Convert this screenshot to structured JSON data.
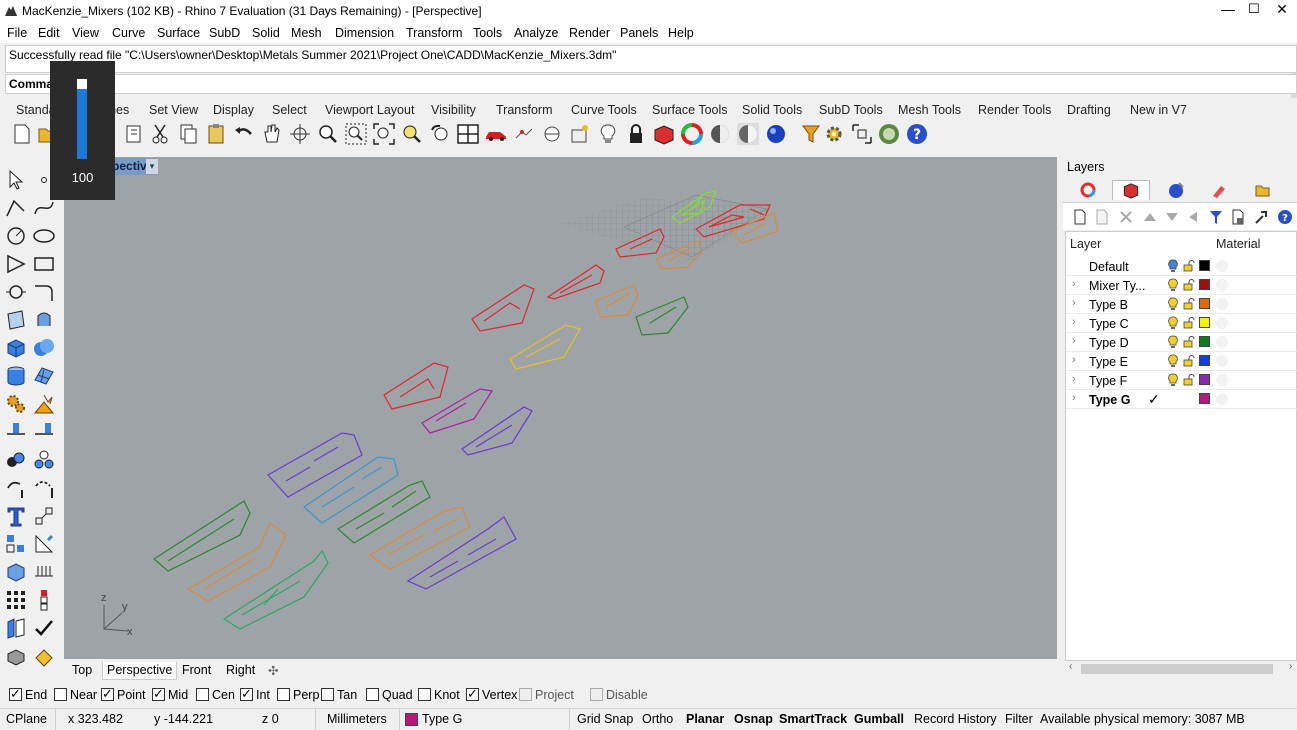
{
  "window": {
    "title": "MacKenzie_Mixers (102 KB) - Rhino 7 Evaluation (31 Days Remaining) - [Perspective]",
    "minimize": "—",
    "maximize": "☐",
    "close": "✕"
  },
  "menu": [
    "File",
    "Edit",
    "View",
    "Curve",
    "Surface",
    "SubD",
    "Solid",
    "Mesh",
    "Dimension",
    "Transform",
    "Tools",
    "Analyze",
    "Render",
    "Panels",
    "Help"
  ],
  "history_text": "Successfully read file \"C:\\Users\\owner\\Desktop\\Metals Summer 2021\\Project One\\CADD\\MacKenzie_Mixers.3dm\"",
  "command_label": "Command:",
  "toolbar_tabs": [
    "Standard",
    "CPlanes",
    "Set View",
    "Display",
    "Select",
    "Viewport Layout",
    "Visibility",
    "Transform",
    "Curve Tools",
    "Surface Tools",
    "Solid Tools",
    "SubD Tools",
    "Mesh Tools",
    "Render Tools",
    "Drafting",
    "New in V7"
  ],
  "toolbar_icons": [
    "new-icon",
    "open-icon",
    "save-icon",
    "print-icon",
    "import-icon",
    "cut-icon",
    "copy-icon",
    "paste-icon",
    "undo-icon",
    "pan-icon",
    "rotate-view-icon",
    "zoom-dynamic-icon",
    "zoom-window-icon",
    "zoom-extents-icon",
    "zoom-selected-icon",
    "undo-view-icon",
    "four-viewports-icon",
    "car-icon",
    "options-icon",
    "cplane-icon",
    "grid-icon",
    "light-icon",
    "lock-icon",
    "shaded-icon",
    "color-wheel-icon",
    "material-icon",
    "rendered-sphere-icon",
    "ghost-sphere-icon",
    "blue-sphere-icon",
    "drafting-icon",
    "settings-icon",
    "gumball-icon",
    "globe-icon",
    "help-icon"
  ],
  "opacity_popup": {
    "value": "100",
    "level": 1.0
  },
  "viewport": {
    "label": "Perspective",
    "dropdown": "▾",
    "axis_x": "x",
    "axis_y": "y",
    "axis_z": "z"
  },
  "view_tabs": [
    "Top",
    "Perspective",
    "Front",
    "Right",
    "✣"
  ],
  "active_view_tab": "Perspective",
  "osnaps": [
    {
      "label": "End",
      "checked": true
    },
    {
      "label": "Near",
      "checked": false
    },
    {
      "label": "Point",
      "checked": true
    },
    {
      "label": "Mid",
      "checked": true
    },
    {
      "label": "Cen",
      "checked": false
    },
    {
      "label": "Int",
      "checked": true
    },
    {
      "label": "Perp",
      "checked": false
    },
    {
      "label": "Tan",
      "checked": false
    },
    {
      "label": "Quad",
      "checked": false
    },
    {
      "label": "Knot",
      "checked": false
    },
    {
      "label": "Vertex",
      "checked": true
    },
    {
      "label": "Project",
      "checked": false
    },
    {
      "label": "Disable",
      "checked": false
    }
  ],
  "status": {
    "cplane": "CPlane",
    "x": "x 323.482",
    "y": "y -144.221",
    "z": "z 0",
    "units": "Millimeters",
    "layer": "Type G",
    "layer_color": "#b8177e",
    "grid_snap": "Grid Snap",
    "ortho": "Ortho",
    "planar": "Planar",
    "osnap": "Osnap",
    "smarttrack": "SmartTrack",
    "gumball": "Gumball",
    "record_history": "Record History",
    "filter": "Filter",
    "memory": "Available physical memory: 3087 MB"
  },
  "layers": {
    "title": "Layers",
    "col_layer": "Layer",
    "col_material": "Material",
    "rows": [
      {
        "name": "Default",
        "color": "#000000",
        "current": false,
        "expand": false
      },
      {
        "name": "Mixer Ty...",
        "color": "#9b1010",
        "current": false,
        "expand": true
      },
      {
        "name": "Type B",
        "color": "#e06a10",
        "current": false,
        "expand": true
      },
      {
        "name": "Type C",
        "color": "#f2f20a",
        "current": false,
        "expand": true
      },
      {
        "name": "Type D",
        "color": "#107a20",
        "current": false,
        "expand": true
      },
      {
        "name": "Type E",
        "color": "#1040e0",
        "current": false,
        "expand": true
      },
      {
        "name": "Type F",
        "color": "#8a2ab0",
        "current": false,
        "expand": true
      },
      {
        "name": "Type G",
        "color": "#b8177e",
        "current": true,
        "expand": true
      }
    ],
    "current_check": "✓"
  },
  "colors": {
    "viewport_bg": "#9ea3a8",
    "red": "#e0262a",
    "orange": "#d98a3a",
    "yellow": "#e8c020",
    "green": "#2a8a2a",
    "lime": "#7ee030",
    "purple": "#6a3ad0",
    "magenta": "#b020a0",
    "blue": "#3a98d0",
    "teal_green": "#2aa860"
  }
}
